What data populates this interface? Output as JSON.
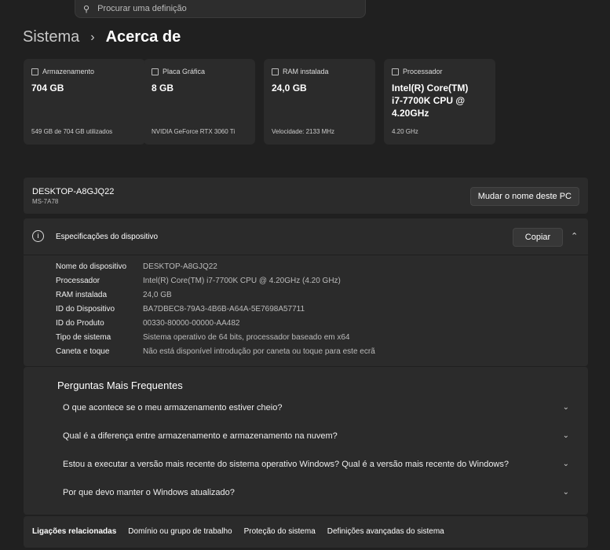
{
  "search": {
    "placeholder": "Procurar uma definição"
  },
  "breadcrumb": {
    "parent": "Sistema",
    "current": "Acerca de"
  },
  "cards": [
    {
      "label": "Armazenamento",
      "value": "704 GB",
      "sub": "549 GB de 704 GB utilizados"
    },
    {
      "label": "Placa Gráfica",
      "value": "8 GB",
      "sub": "NVIDIA GeForce RTX 3060 Ti"
    },
    {
      "label": "RAM instalada",
      "value": "24,0 GB",
      "sub": "Velocidade: 2133 MHz"
    },
    {
      "label": "Processador",
      "value": "Intel(R) Core(TM) i7-7700K CPU @ 4.20GHz",
      "sub": "4.20 GHz"
    }
  ],
  "device": {
    "name": "DESKTOP-A8GJQ22",
    "model": "MS-7A78",
    "rename_label": "Mudar o nome deste PC"
  },
  "specs": {
    "title": "Especificações do dispositivo",
    "copy_label": "Copiar",
    "rows": [
      {
        "k": "Nome do dispositivo",
        "v": "DESKTOP-A8GJQ22"
      },
      {
        "k": "Processador",
        "v": "Intel(R) Core(TM) i7-7700K CPU @ 4.20GHz (4.20 GHz)"
      },
      {
        "k": "RAM instalada",
        "v": "24,0 GB"
      },
      {
        "k": "ID do Dispositivo",
        "v": "BA7DBEC8-79A3-4B6B-A64A-5E7698A57711"
      },
      {
        "k": "ID do Produto",
        "v": "00330-80000-00000-AA482"
      },
      {
        "k": "Tipo de sistema",
        "v": "Sistema operativo de 64 bits, processador baseado em x64"
      },
      {
        "k": "Caneta e toque",
        "v": "Não está disponível introdução por caneta ou toque para este ecrã"
      }
    ]
  },
  "faq": {
    "title": "Perguntas Mais Frequentes",
    "items": [
      "O que acontece se o meu armazenamento estiver cheio?",
      "Qual é a diferença entre armazenamento e armazenamento na nuvem?",
      "Estou a executar a versão mais recente do sistema operativo Windows? Qual é a versão mais recente do Windows?",
      "Por que devo manter o Windows atualizado?"
    ]
  },
  "related": {
    "title": "Ligações relacionadas",
    "links": [
      "Domínio ou grupo de trabalho",
      "Proteção do sistema",
      "Definições avançadas do sistema"
    ]
  }
}
